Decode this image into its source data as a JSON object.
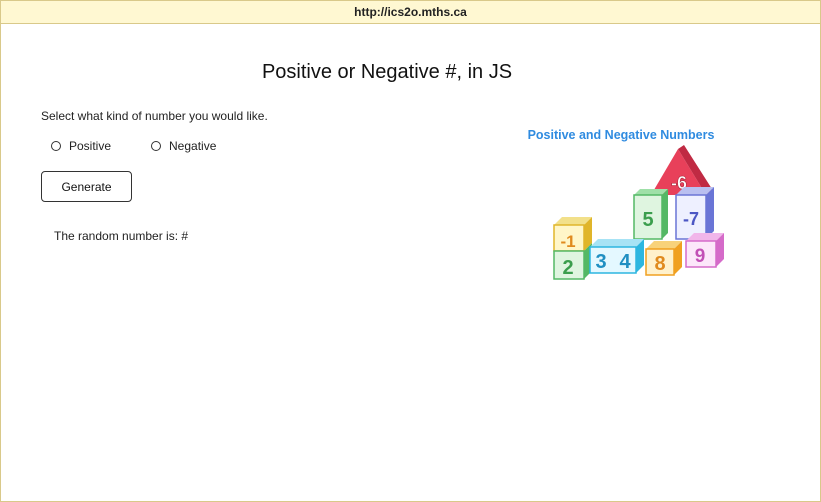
{
  "browser": {
    "url": "http://ics2o.mths.ca"
  },
  "page": {
    "title": "Positive or Negative #, in JS",
    "prompt": "Select what kind of number you would like.",
    "options": [
      {
        "label": "Positive"
      },
      {
        "label": "Negative"
      }
    ],
    "button_label": "Generate",
    "result_text": "The random number is: #"
  },
  "illustration": {
    "heading": "Positive and Negative Numbers",
    "blocks": [
      "-6",
      "5",
      "-7",
      "-1",
      "2",
      "3",
      "4",
      "8",
      "9"
    ]
  },
  "colors": {
    "url_bar_bg": "#fff8d2",
    "frame_border": "#d9c98a",
    "heading_blue": "#2f8be0"
  }
}
